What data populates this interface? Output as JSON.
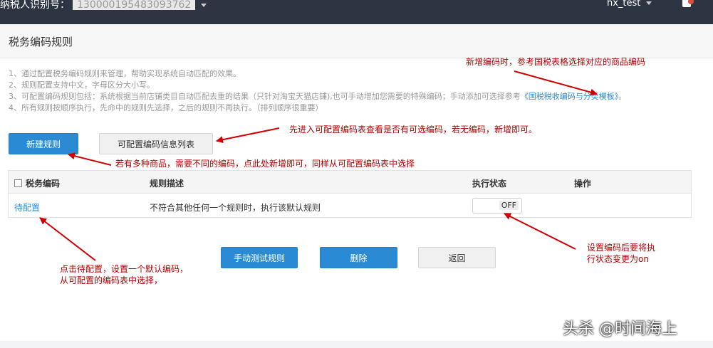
{
  "topbar": {
    "taxid_label": "纳税人识别号：",
    "taxid_value": "130000195483093762",
    "user": "hx_test"
  },
  "page": {
    "title": "税务编码规则"
  },
  "notes": [
    "1、通过配置税务编码规则来管理，帮助实现系统自动匹配的效果。",
    "2、规则配置支持中文，字母区分大小写。",
    "3、可配置编码规则包括：系统根据当前店铺类目自动匹配去重的结果（只针对淘宝天猫店铺),也可手动增加您需要的特殊编码；手动添加可选择参考",
    "4、所有规则按顺序执行，先命中的规则先选择，之后的规则不再执行。（排列顺序很重要）"
  ],
  "notes_link": "《国税税收编码与分类模板》",
  "notes_link_suffix": "。",
  "buttons": {
    "new_rule": "新建规则",
    "config_list": "可配置编码信息列表",
    "manual_test": "手动测试规则",
    "delete": "删除",
    "back": "返回"
  },
  "table": {
    "headers": [
      "税务编码",
      "规则描述",
      "执行状态",
      "操作"
    ],
    "rows": [
      {
        "code": "待配置",
        "description": "不符合其他任何一个规则时，执行该默认规则",
        "status": "OFF"
      }
    ]
  },
  "annotations": {
    "top_right": "新增编码时，参考国税表格选择对应的商品编码",
    "config_list": "先进入可配置编码表查看是否有可选编码，若无编码，新增即可。",
    "new_rule": "若有多种商品，需要不同的编码，点此处新增即可，同样从可配置编码表中选择",
    "status_line1": "设置编码后要将执",
    "status_line2": "行状态变更为on",
    "pending_line1": "点击待配置，设置一个默认编码，",
    "pending_line2": "从可配置的编码表中选择，"
  },
  "watermark": "头杀 @时间海上",
  "colors": {
    "topbar": "#2c3541",
    "primary": "#2b8ad4",
    "annotation": "#b40000"
  }
}
